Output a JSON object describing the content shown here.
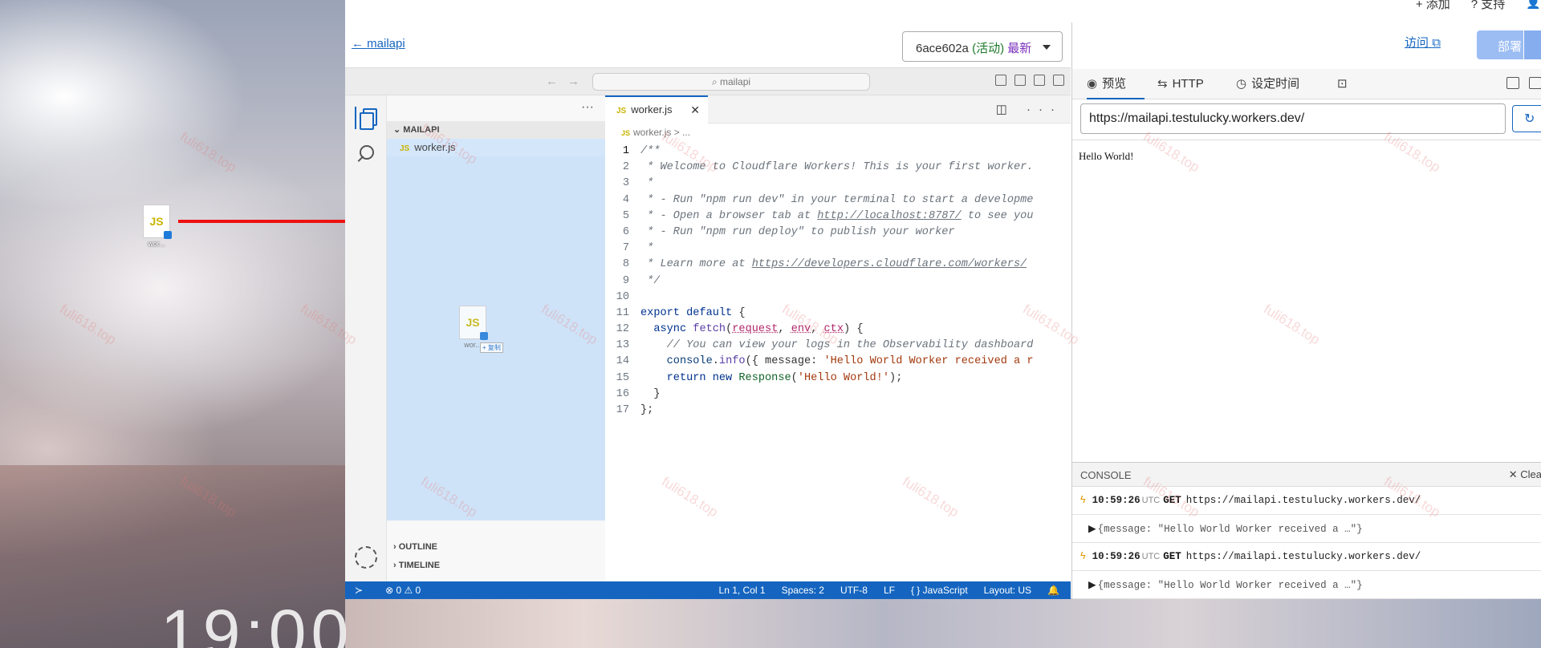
{
  "desktop": {
    "file_label": "wor...",
    "clock": "19:00",
    "watermark": "fuli618.top"
  },
  "header": {
    "top_links": [
      "+ 添加",
      "? 支持"
    ],
    "back_label": "mailapi",
    "version": {
      "hash": "6ace602a",
      "status": "(活动)",
      "latest": "最新"
    }
  },
  "editor": {
    "search_placeholder": "mailapi",
    "explorer_section": "MAILAPI",
    "explorer_file": "worker.js",
    "drag_ghost_label": "wor...",
    "drag_copy_label": "+ 复制",
    "outline_label": "OUTLINE",
    "timeline_label": "TIMELINE",
    "tab_label": "worker.js",
    "breadcrumb": "worker.js > ...",
    "js_badge": "JS",
    "line_numbers": [
      "1",
      "2",
      "3",
      "4",
      "5",
      "6",
      "7",
      "8",
      "9",
      "10",
      "11",
      "12",
      "13",
      "14",
      "15",
      "16",
      "17"
    ],
    "status": {
      "problems": "⊗ 0 ⚠ 0",
      "position": "Ln 1, Col 1",
      "spaces": "Spaces: 2",
      "encoding": "UTF-8",
      "eol": "LF",
      "language": "{ } JavaScript",
      "layout": "Layout: US"
    }
  },
  "preview": {
    "visit_label": "访问",
    "deploy_label": "部署",
    "tabs": [
      {
        "icon": "eye-icon",
        "label": "预览"
      },
      {
        "icon": "swap-icon",
        "label": "HTTP"
      },
      {
        "icon": "clock-icon",
        "label": "设定时间"
      },
      {
        "icon": "terminal-icon",
        "label": ""
      }
    ],
    "url": "https://mailapi.testulucky.workers.dev/",
    "body_text": "Hello World!",
    "console": {
      "title": "CONSOLE",
      "clear_label": "✕ Clea",
      "entries": [
        {
          "time": "10:59:26",
          "tz": "UTC",
          "method": "GET",
          "url": "https://mailapi.testulucky.workers.dev/",
          "message": "{message: \"Hello World Worker received a …\"}"
        },
        {
          "time": "10:59:26",
          "tz": "UTC",
          "method": "GET",
          "url": "https://mailapi.testulucky.workers.dev/",
          "message": "{message: \"Hello World Worker received a …\"}"
        }
      ]
    }
  }
}
